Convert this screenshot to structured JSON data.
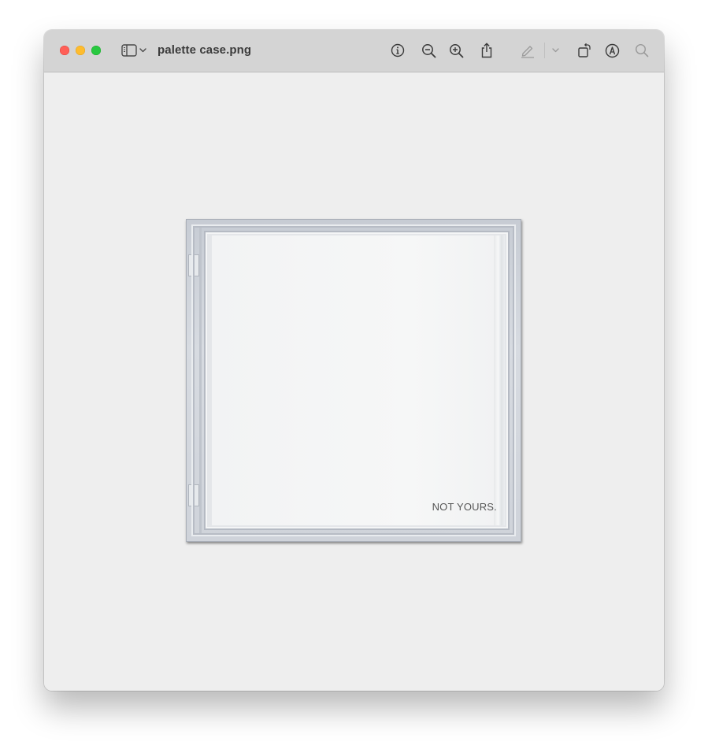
{
  "window": {
    "title": "palette case.png"
  },
  "toolbar": {
    "icons": [
      "sidebar-toggle-icon",
      "chevron-down-icon",
      "info-icon",
      "zoom-out-icon",
      "zoom-in-icon",
      "share-icon",
      "markup-pen-icon",
      "chevron-down-icon",
      "rotate-icon",
      "markup-icon",
      "search-icon"
    ]
  },
  "image": {
    "label": "NOT YOURS."
  },
  "colors": {
    "close": "#ff5f57",
    "minimize": "#febc2e",
    "zoom": "#28c840",
    "titlebar": "#d4d4d4",
    "canvas": "#eeeeee"
  }
}
